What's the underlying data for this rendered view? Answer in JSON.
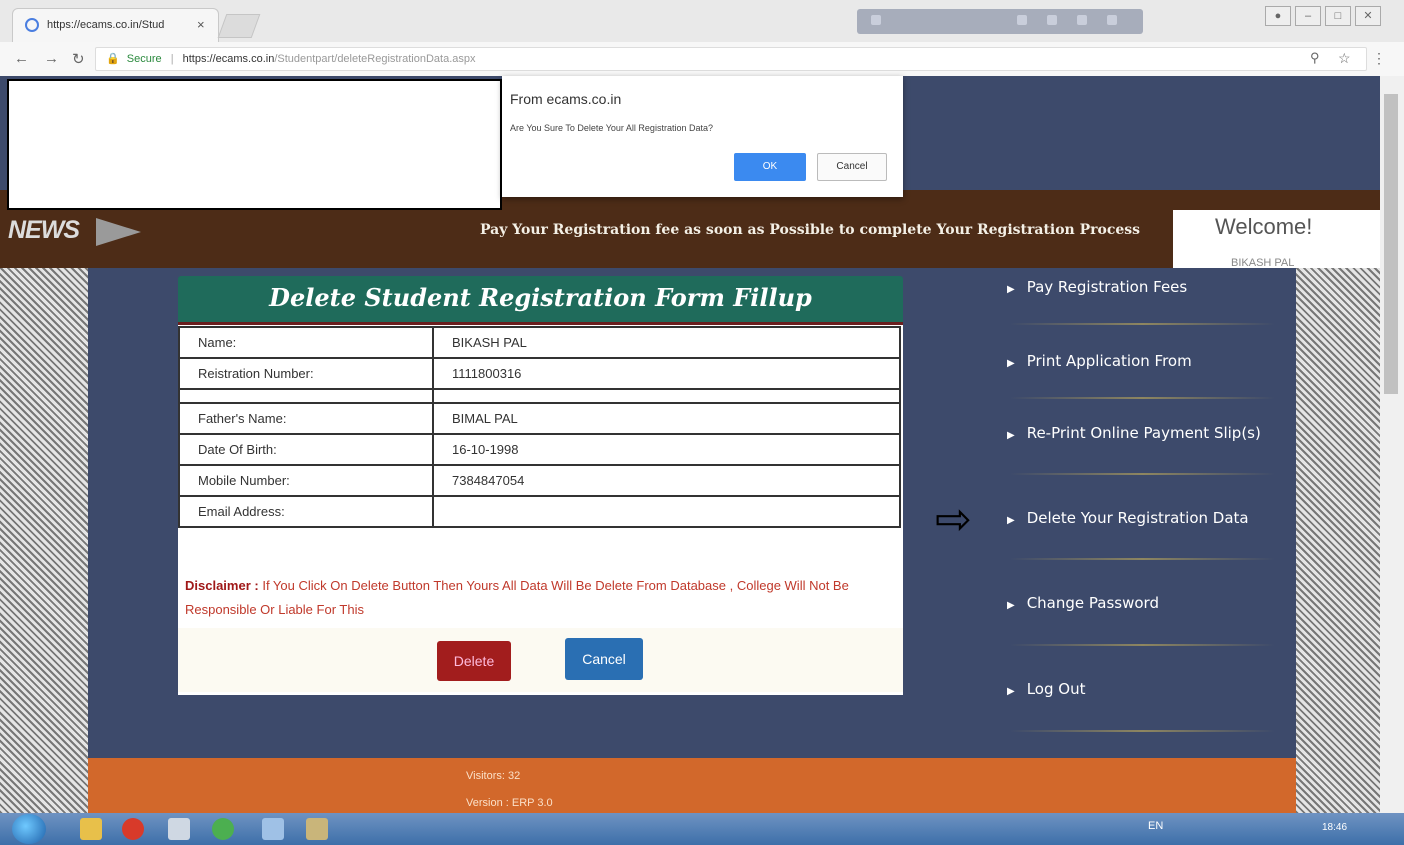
{
  "browser": {
    "tab_title": "https://ecams.co.in/Stud",
    "tab_close": "×",
    "secure_label": "Secure",
    "url_host": "https://ecams.co.in",
    "url_path": "/Studentpart/deleteRegistrationData.aspx"
  },
  "dialog": {
    "from": "From ecams.co.in",
    "message": "Are You Sure To Delete Your All Registration Data?",
    "ok_label": "OK",
    "cancel_label": "Cancel"
  },
  "header": {
    "news_label": "NEWS",
    "marquee": "Pay Your Registration fee as soon as Possible to complete Your Registration Process",
    "welcome_label": "Welcome!",
    "welcome_user": "BIKASH PAL"
  },
  "form": {
    "title": "Delete Student Registration Form Fillup",
    "rows": [
      {
        "label": "Name:",
        "value": "BIKASH PAL"
      },
      {
        "label": "Reistration Number:",
        "value": "1111800316"
      },
      {
        "label": "Father's Name:",
        "value": "BIMAL PAL"
      },
      {
        "label": "Date Of Birth:",
        "value": "16-10-1998"
      },
      {
        "label": "Mobile Number:",
        "value": "7384847054"
      },
      {
        "label": "Email Address:",
        "value": ""
      }
    ],
    "disclaimer_label": "Disclaimer :",
    "disclaimer_text": "If You Click On Delete Button Then Yours All Data Will Be Delete From Database , College Will Not Be Responsible Or Liable For This",
    "delete_label": "Delete",
    "cancel_label": "Cancel"
  },
  "menu": {
    "items": [
      {
        "label": "Pay Registration Fees"
      },
      {
        "label": "Print Application From"
      },
      {
        "label": "Re-Print Online Payment Slip(s)"
      },
      {
        "label": "Delete Your Registration Data"
      },
      {
        "label": "Change Password"
      },
      {
        "label": "Log Out"
      }
    ]
  },
  "footer": {
    "visitors": "Visitors: 32",
    "version": "Version : ERP 3.0"
  },
  "taskbar": {
    "lang": "EN",
    "clock": "18:46"
  },
  "colors": {
    "page_blue": "#3d4a6b",
    "news_brown": "#4d2c17",
    "form_header_green": "#1f6b5b",
    "footer_orange": "#d2682b",
    "delete_red": "#a21d1d",
    "cancel_blue": "#2a6fb3"
  }
}
